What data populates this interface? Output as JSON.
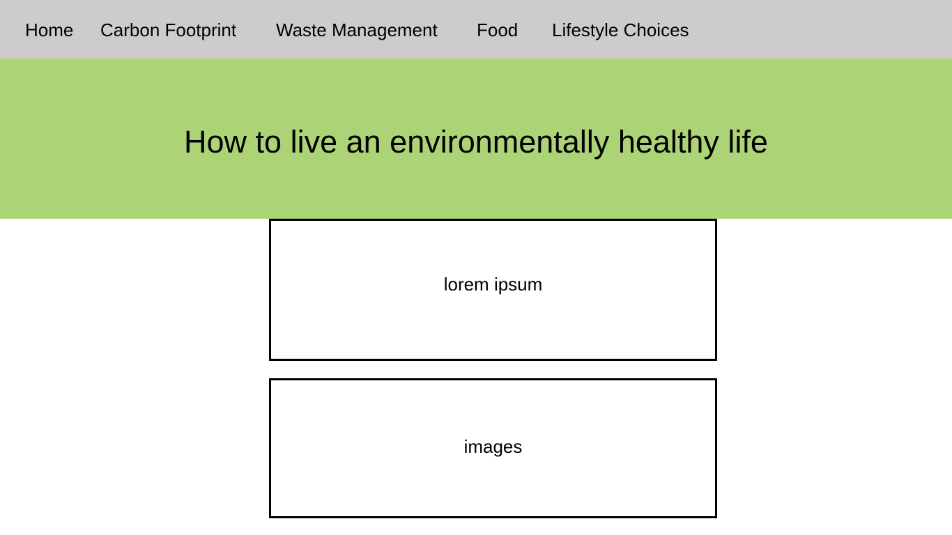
{
  "nav": {
    "items": [
      {
        "label": "Home"
      },
      {
        "label": "Carbon Footprint"
      },
      {
        "label": "Waste Management"
      },
      {
        "label": "Food"
      },
      {
        "label": "Lifestyle Choices"
      }
    ]
  },
  "hero": {
    "title": "How to live an environmentally healthy life"
  },
  "boxes": [
    {
      "text": "lorem ipsum"
    },
    {
      "text": "images"
    }
  ],
  "colors": {
    "nav_background": "#cccccc",
    "hero_background": "#acd375",
    "page_background": "#ffffff",
    "border": "#000000"
  }
}
